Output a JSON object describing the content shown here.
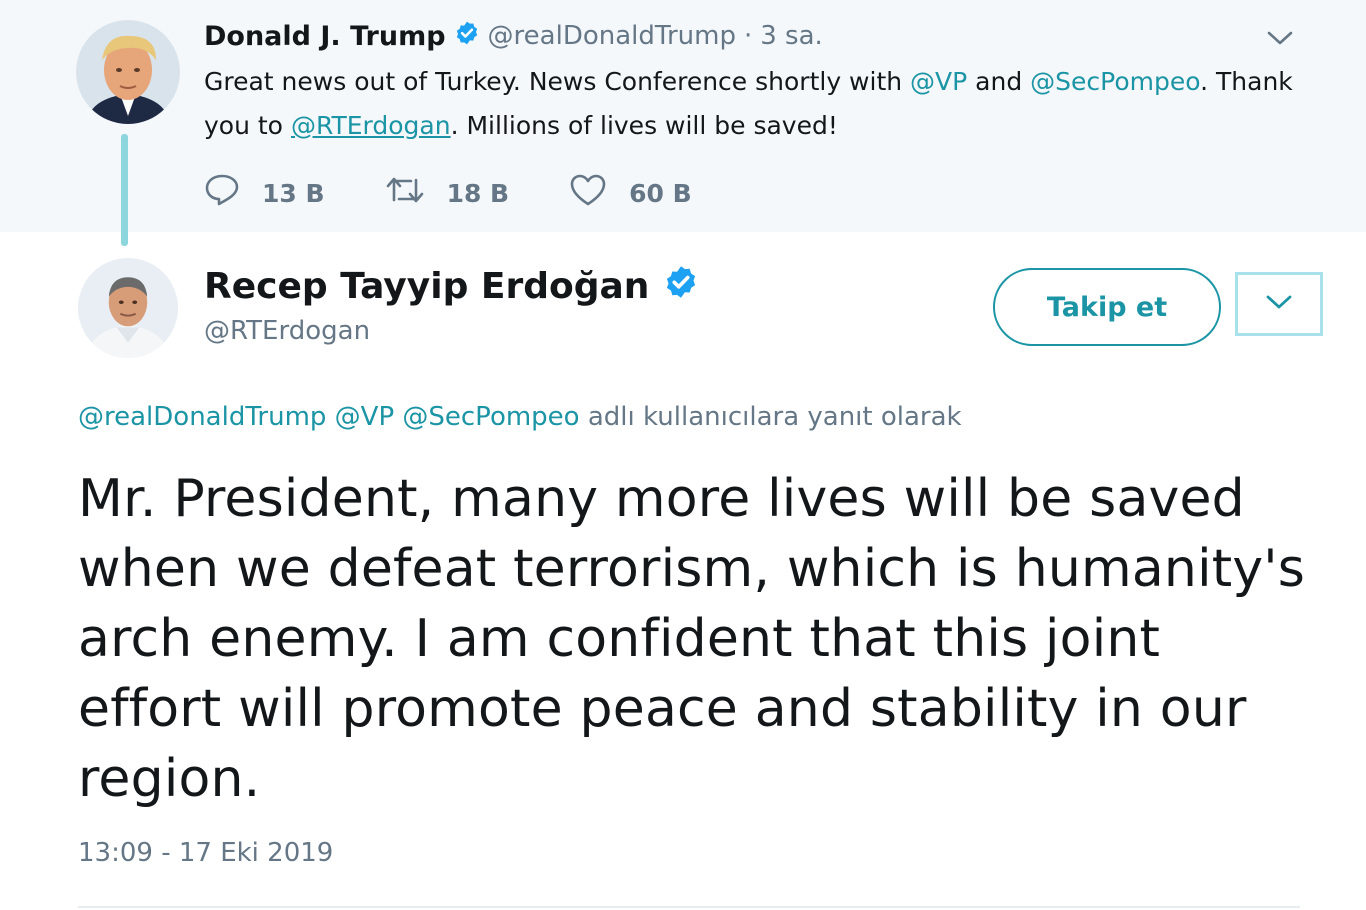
{
  "parent_tweet": {
    "name": "Donald J. Trump",
    "handle": "@realDonaldTrump",
    "dot": "·",
    "time": "3 sa.",
    "text_part1": "Great news out of Turkey. News Conference shortly with ",
    "mention_vp": "@VP",
    "text_and": " and ",
    "mention_pompeo": "@SecPompeo",
    "text_part2": ". Thank you to ",
    "mention_erdogan": "@RTErdogan",
    "text_part3": ". Millions of lives will be saved!",
    "actions": {
      "reply_count": "13 B",
      "retweet_count": "18 B",
      "like_count": "60 B"
    }
  },
  "tweet": {
    "name": "Recep Tayyip Erdoğan",
    "handle": "@RTErdogan",
    "follow_label": "Takip et",
    "reply_mentions": "@realDonaldTrump @VP @SecPompeo",
    "reply_suffix": " adlı kullanıcılara yanıt olarak",
    "text": "Mr. President, many more lives will be saved when we defeat terrorism, which is humanity's arch enemy. I am confident that this joint effort will promote peace and stability in our region.",
    "timestamp": "13:09 - 17 Eki 2019"
  },
  "icons": {
    "verified": "verified-badge-icon",
    "reply": "reply-icon",
    "retweet": "retweet-icon",
    "like": "heart-icon",
    "menu": "chevron-down-icon"
  },
  "colors": {
    "accent": "#1b95a5",
    "verified": "#1da1f2",
    "secondary_text": "#657786",
    "parent_background": "#f5f8fa",
    "thread_line": "#8ed6de"
  }
}
